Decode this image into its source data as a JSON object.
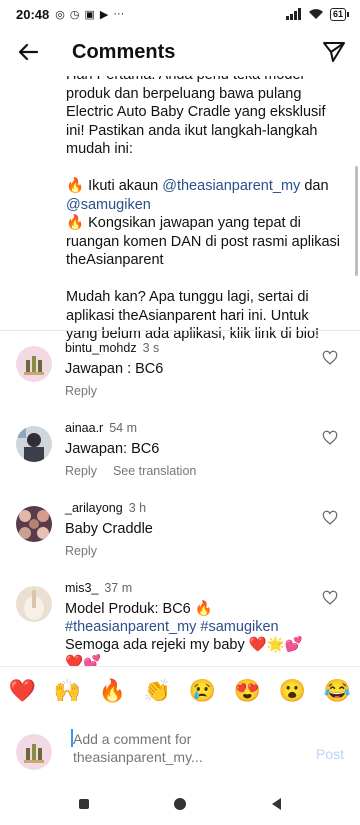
{
  "status_bar": {
    "time": "20:48",
    "battery": "61"
  },
  "header": {
    "title": "Comments"
  },
  "caption": {
    "line1": "Hari Pertama. Anda perlu teka model",
    "line2": "produk dan berpeluang bawa pulang",
    "line3": "Electric Auto Baby Cradle yang eksklusif",
    "line4": "ini! Pastikan anda ikut langkah-langkah",
    "line5": "mudah ini:",
    "step1_prefix": "🔥 Ikuti akaun ",
    "step1_mention1": "@theasianparent_my",
    "step1_and": " dan",
    "step1_mention2": "@samugiken",
    "step2_line1": "🔥 Kongsikan jawapan yang tepat di",
    "step2_line2": "ruangan komen DAN di post rasmi aplikasi",
    "step2_line3": "theAsianparent",
    "outro_line1": "Mudah kan? Apa tunggu lagi, sertai di",
    "outro_line2": "aplikasi theAsianparent hari ini. Untuk",
    "outro_line3": "yang belum ada aplikasi, klik link di bio!"
  },
  "comments": [
    {
      "username": "bintu_mohdz",
      "ago": "3 s",
      "text": "Jawapan : BC6",
      "reply": "Reply"
    },
    {
      "username": "ainaa.r",
      "ago": "54 m",
      "text": "Jawapan: BC6",
      "reply": "Reply",
      "translate": "See translation"
    },
    {
      "username": "_arilayong",
      "ago": "3 h",
      "text": "Baby Craddle",
      "reply": "Reply"
    },
    {
      "username": "mis3_",
      "ago": "37 m",
      "text_line1": "Model Produk: BC6 🔥",
      "hashtags": "#theasianparent_my #samugiken",
      "text_line3": "Semoga ada rejeki my baby ❤️🌟💕",
      "text_line4": "❤️💕"
    }
  ],
  "emojis": [
    "❤️",
    "🙌",
    "🔥",
    "👏",
    "😢",
    "😍",
    "😮",
    "😂"
  ],
  "composer": {
    "placeholder": "Add a comment for theasianparent_my...",
    "post_label": "Post"
  },
  "colors": {
    "mention": "#2b4f8a",
    "post_disabled": "#b7d6f7",
    "cursor": "#3897f0"
  }
}
